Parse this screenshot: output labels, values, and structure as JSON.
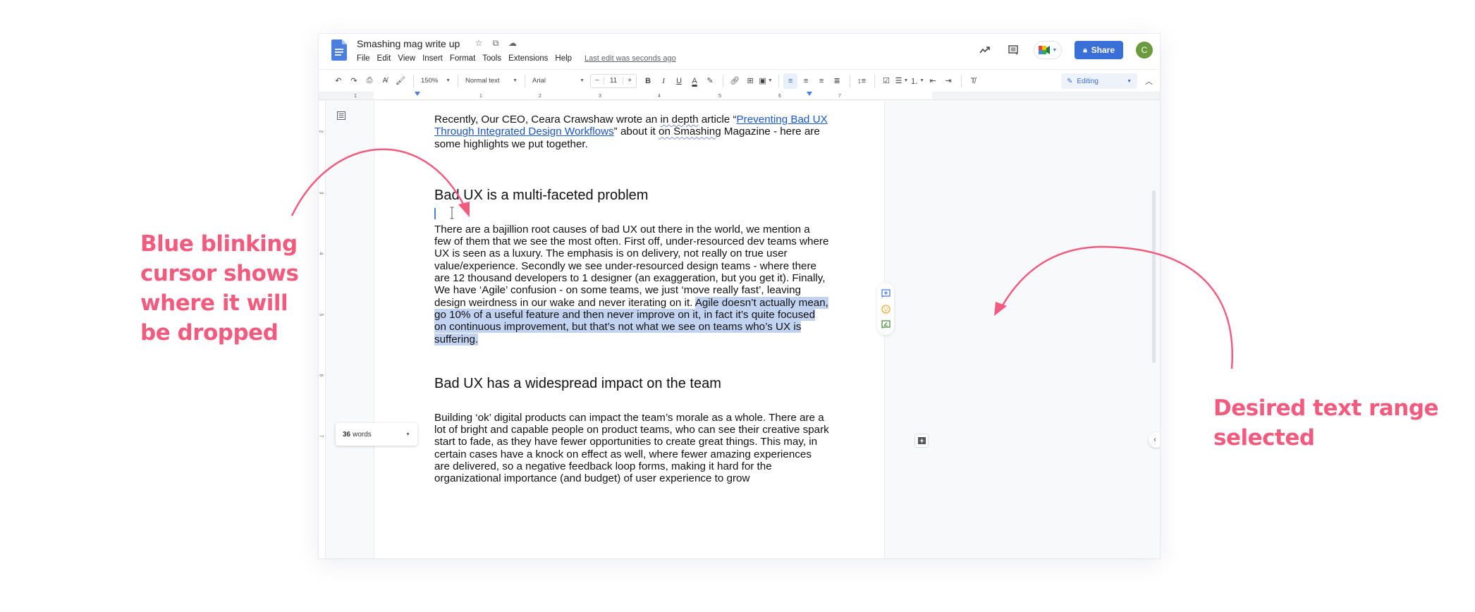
{
  "window": {
    "doc_title": "Smashing mag write up",
    "title_icons": [
      "star-icon",
      "move-to-folder-icon",
      "cloud-saved-icon"
    ],
    "menu": [
      "File",
      "Edit",
      "View",
      "Insert",
      "Format",
      "Tools",
      "Extensions",
      "Help"
    ],
    "last_edit": "Last edit was seconds ago",
    "share_label": "Share",
    "avatar_initial": "C",
    "editing_mode": "Editing"
  },
  "toolbar": {
    "zoom": "150%",
    "style": "Normal text",
    "font": "Arial",
    "font_size": "11",
    "minus": "−",
    "plus": "+",
    "bold": "B",
    "italic": "I",
    "underline": "U",
    "text_color": "A"
  },
  "ruler": {
    "h_ticks": [
      "1",
      "1",
      "2",
      "3",
      "4",
      "5",
      "6",
      "7"
    ],
    "v_ticks": [
      "2",
      "3",
      "4",
      "5",
      "6",
      "7"
    ]
  },
  "document": {
    "intro_pre": "Recently, Our CEO, Ceara Crawshaw wrote an ",
    "intro_spell1": "in depth",
    "intro_mid": " article “",
    "intro_link": "Preventing Bad UX Through Integrated Design Workflows",
    "intro_post1": "” about it ",
    "intro_spell2": "on Smashing",
    "intro_post2": " Magazine - here are some highlights we put together.",
    "heading1": "Bad UX is a multi-faceted problem",
    "para1_plain": "There are a bajillion root causes of bad UX out there in the world, we mention a few of them that we see the most often. First off, under-resourced dev teams where UX is seen as a luxury. The emphasis is on delivery, not really on true user value/experience. Secondly we see under-resourced design teams - where there are 12 thousand developers to 1 designer (an exaggeration, but you get it). Finally, We have ‘Agile’ confusion - on some teams, we just ‘move really fast’, leaving design weirdness in our wake and never iterating on it. ",
    "para1_selected": "Agile doesn’t actually mean, go 10% of a useful feature and then never improve on it, in fact it’s quite focused on continuous improvement, but that’s not what we see on teams who’s UX is suffering.",
    "heading2": "Bad UX has a widespread impact on the team",
    "para2": "Building ‘ok’ digital products can impact the team’s morale as a whole. There are a lot of bright and capable people on product teams, who can see their creative spark start to fade, as they have fewer opportunities to create great things. This may, in certain cases have a knock on effect as well, where fewer amazing experiences are delivered, so a negative feedback loop forms, making it hard for the organizational importance (and budget) of user experience to grow"
  },
  "word_count": {
    "count": "36",
    "label": "words"
  },
  "annotations": {
    "left": "Blue blinking cursor shows where it will be dropped",
    "right": "Desired text range selected"
  },
  "colors": {
    "accent": "#3b6fd8",
    "selection": "#c2d3f2",
    "annotation": "#f25a7e",
    "avatar": "#6b9a3f"
  }
}
